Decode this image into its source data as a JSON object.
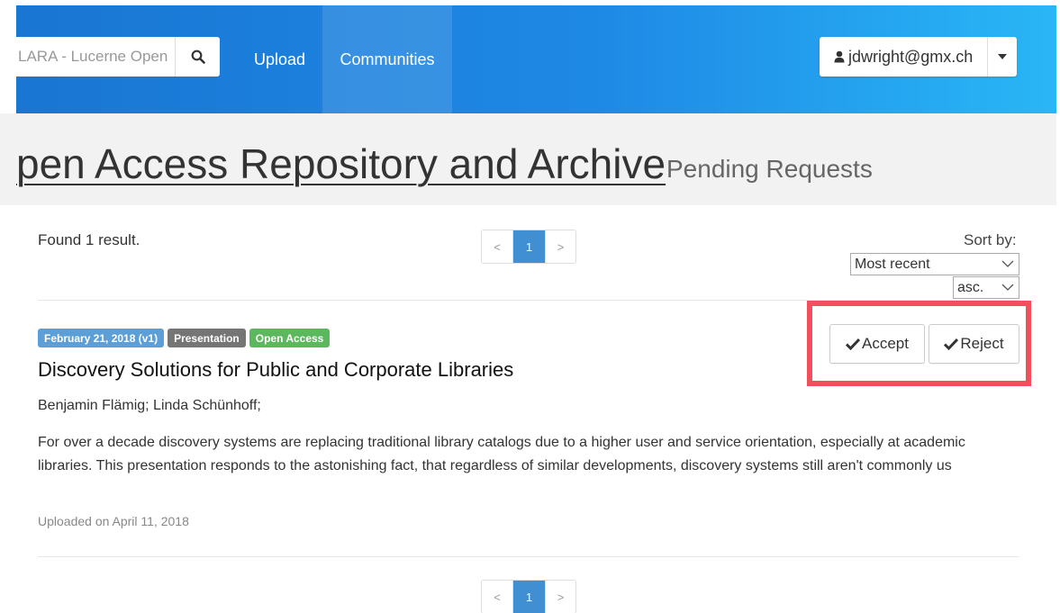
{
  "navbar": {
    "search_value": "LARA - Lucerne Open",
    "upload_label": "Upload",
    "communities_label": "Communities",
    "user_label": "jdwright@gmx.ch"
  },
  "header": {
    "repo_title": "pen Access Repository and Archive",
    "page_subtitle": "Pending Requests"
  },
  "results": {
    "found_text": "Found 1 result.",
    "pagination": {
      "prev": "<",
      "current": "1",
      "next": ">"
    },
    "sort_label": "Sort by:",
    "sort_field": "Most recent",
    "sort_order": "asc."
  },
  "record": {
    "date_badge": "February 21, 2018 (v1)",
    "type_badge": "Presentation",
    "access_badge": "Open Access",
    "title": "Discovery Solutions for Public and Corporate Libraries",
    "authors": "Benjamin Flämig; Linda Schünhoff;",
    "abstract": "For over a decade discovery systems are replacing traditional library catalogs due to a higher user and service orientation, especially at academic libraries. This presentation responds to the astonishing fact, that regardless of similar developments, discovery systems still aren't commonly us",
    "uploaded": "Uploaded on April 11, 2018",
    "accept_label": "Accept",
    "reject_label": "Reject"
  },
  "colors": {
    "navbar_gradient_start": "#1976d2",
    "navbar_gradient_end": "#29b6f6",
    "highlight": "#f24e5b",
    "badge_date": "#5c9fd6",
    "badge_type": "#757575",
    "badge_access": "#5cb85c",
    "pagination_active": "#3f8fd2"
  }
}
